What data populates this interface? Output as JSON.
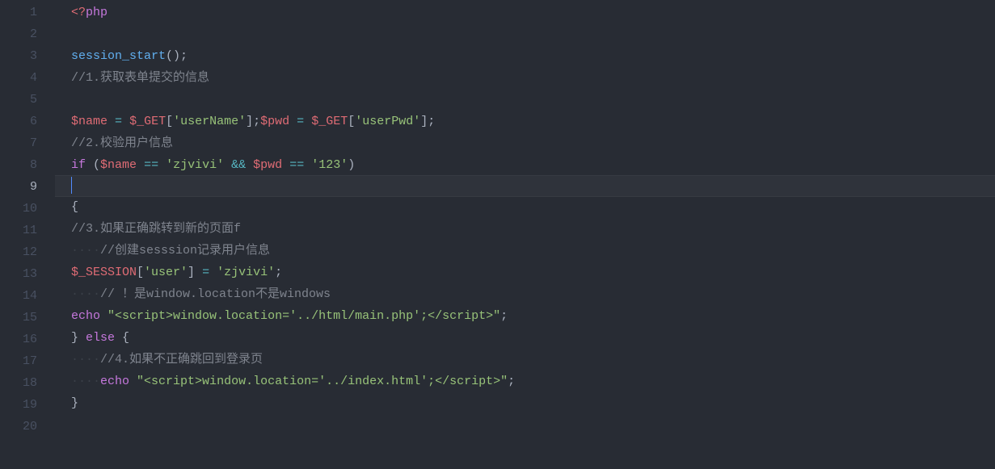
{
  "editor": {
    "language": "php",
    "currentLine": 9,
    "lineNumbers": [
      "1",
      "2",
      "3",
      "4",
      "5",
      "6",
      "7",
      "8",
      "9",
      "10",
      "11",
      "12",
      "13",
      "14",
      "15",
      "16",
      "17",
      "18",
      "19",
      "20"
    ],
    "lines": [
      [
        {
          "t": "<?",
          "c": "tag"
        },
        {
          "t": "php",
          "c": "keyword"
        }
      ],
      [],
      [
        {
          "t": "session_start",
          "c": "func"
        },
        {
          "t": "();",
          "c": "default"
        }
      ],
      [
        {
          "t": "//1.获取表单提交的信息",
          "c": "comment"
        }
      ],
      [],
      [
        {
          "t": "$name",
          "c": "var"
        },
        {
          "t": " ",
          "c": "default"
        },
        {
          "t": "=",
          "c": "op"
        },
        {
          "t": " ",
          "c": "default"
        },
        {
          "t": "$_GET",
          "c": "global"
        },
        {
          "t": "[",
          "c": "default"
        },
        {
          "t": "'userName'",
          "c": "string"
        },
        {
          "t": "];",
          "c": "default"
        },
        {
          "t": "$pwd",
          "c": "var"
        },
        {
          "t": " ",
          "c": "default"
        },
        {
          "t": "=",
          "c": "op"
        },
        {
          "t": " ",
          "c": "default"
        },
        {
          "t": "$_GET",
          "c": "global"
        },
        {
          "t": "[",
          "c": "default"
        },
        {
          "t": "'userPwd'",
          "c": "string"
        },
        {
          "t": "];",
          "c": "default"
        }
      ],
      [
        {
          "t": "//2.校验用户信息",
          "c": "comment"
        }
      ],
      [
        {
          "t": "if",
          "c": "keyword"
        },
        {
          "t": " (",
          "c": "default"
        },
        {
          "t": "$name",
          "c": "var"
        },
        {
          "t": " ",
          "c": "default"
        },
        {
          "t": "==",
          "c": "op"
        },
        {
          "t": " ",
          "c": "default"
        },
        {
          "t": "'zjvivi'",
          "c": "string"
        },
        {
          "t": " ",
          "c": "default"
        },
        {
          "t": "&&",
          "c": "op"
        },
        {
          "t": " ",
          "c": "default"
        },
        {
          "t": "$pwd",
          "c": "var"
        },
        {
          "t": " ",
          "c": "default"
        },
        {
          "t": "==",
          "c": "op"
        },
        {
          "t": " ",
          "c": "default"
        },
        {
          "t": "'123'",
          "c": "string"
        },
        {
          "t": ")",
          "c": "default"
        }
      ],
      [],
      [
        {
          "t": "{",
          "c": "default"
        }
      ],
      [
        {
          "t": "//3.如果正确跳转到新的页面f",
          "c": "comment"
        }
      ],
      [
        {
          "t": "····",
          "c": "ws"
        },
        {
          "t": "//创建sesssion记录用户信息",
          "c": "comment"
        }
      ],
      [
        {
          "t": "$_SESSION",
          "c": "global"
        },
        {
          "t": "[",
          "c": "default"
        },
        {
          "t": "'user'",
          "c": "string"
        },
        {
          "t": "] ",
          "c": "default"
        },
        {
          "t": "=",
          "c": "op"
        },
        {
          "t": " ",
          "c": "default"
        },
        {
          "t": "'zjvivi'",
          "c": "string"
        },
        {
          "t": ";",
          "c": "default"
        }
      ],
      [
        {
          "t": "····",
          "c": "ws"
        },
        {
          "t": "// ！是window.location不是windows",
          "c": "comment"
        }
      ],
      [
        {
          "t": "echo",
          "c": "keyword"
        },
        {
          "t": " ",
          "c": "default"
        },
        {
          "t": "\"<script>window.location='../html/main.php';</script>\"",
          "c": "string"
        },
        {
          "t": ";",
          "c": "default"
        }
      ],
      [
        {
          "t": "} ",
          "c": "default"
        },
        {
          "t": "else",
          "c": "keyword"
        },
        {
          "t": " {",
          "c": "default"
        }
      ],
      [
        {
          "t": "····",
          "c": "ws"
        },
        {
          "t": "//4.如果不正确跳回到登录页",
          "c": "comment"
        }
      ],
      [
        {
          "t": "····",
          "c": "ws"
        },
        {
          "t": "echo",
          "c": "keyword"
        },
        {
          "t": " ",
          "c": "default"
        },
        {
          "t": "\"<script>window.location='../index.html';</script>\"",
          "c": "string"
        },
        {
          "t": ";",
          "c": "default"
        }
      ],
      [
        {
          "t": "}",
          "c": "default"
        }
      ],
      []
    ]
  }
}
